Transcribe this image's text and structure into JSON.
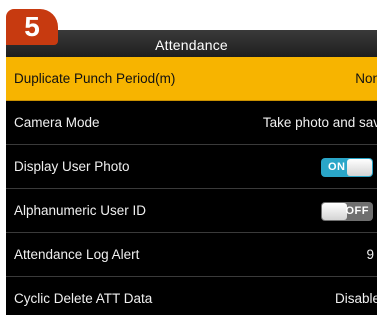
{
  "step_badge": "5",
  "header": {
    "title": "Attendance"
  },
  "settings": [
    {
      "label": "Duplicate Punch Period(m)",
      "value": "Non"
    },
    {
      "label": "Camera Mode",
      "value": "Take photo and sav"
    },
    {
      "label": "Display User Photo",
      "toggle": "ON"
    },
    {
      "label": "Alphanumeric User ID",
      "toggle": "OFF"
    },
    {
      "label": "Attendance Log Alert",
      "value": "9"
    },
    {
      "label": "Cyclic Delete ATT Data",
      "value": "Disable"
    }
  ],
  "colors": {
    "selected_row": "#f7b400",
    "toggle_on": "#2aa6c8",
    "toggle_off": "#6f6f6f",
    "badge": "#c73a10",
    "screen_background": "#000000"
  }
}
